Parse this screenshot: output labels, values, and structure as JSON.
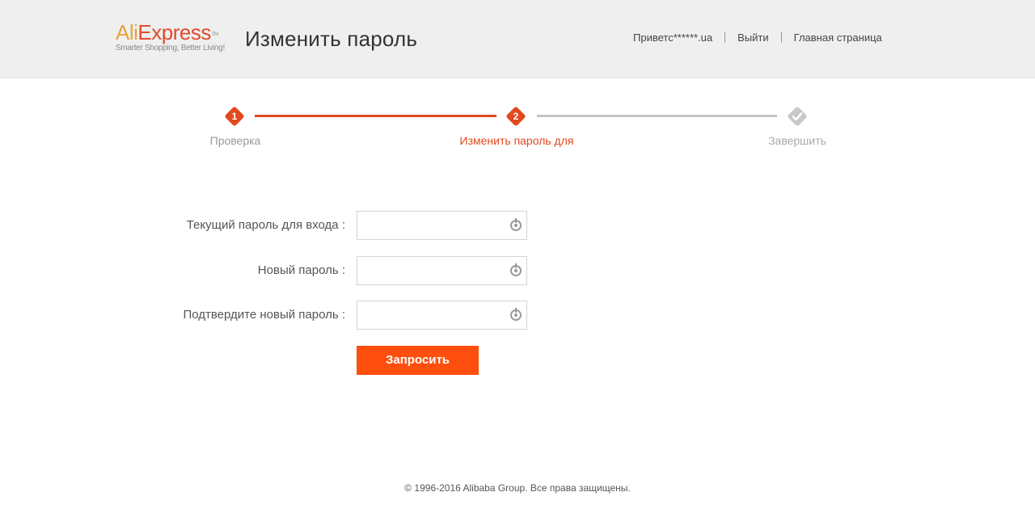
{
  "header": {
    "logo_main_a": "Ali",
    "logo_main_b": "Express",
    "logo_tm": "TM",
    "logo_tagline": "Smarter Shopping, Better Living!",
    "title": "Изменить пароль",
    "nav": {
      "greeting": "Приветс******.ua",
      "logout": "Выйти",
      "home": "Главная страница"
    }
  },
  "steps": [
    {
      "number": "1",
      "label": "Проверка",
      "state": "done"
    },
    {
      "number": "2",
      "label": "Изменить пароль для",
      "state": "active"
    },
    {
      "number": "",
      "label": "Завершить",
      "state": "pending",
      "icon": "checkmark-icon"
    }
  ],
  "form": {
    "current_password_label": "Текущий пароль для входа :",
    "current_password_value": "",
    "new_password_label": "Новый пароль :",
    "new_password_value": "",
    "confirm_password_label": "Подтвердите новый пароль :",
    "confirm_password_value": "",
    "submit_label": "Запросить"
  },
  "footer": {
    "copyright": "© 1996-2016 Alibaba Group. Все права защищены."
  },
  "colors": {
    "accent": "#e24a1e",
    "button": "#ff4f0e",
    "header_bg": "#efefef",
    "inactive": "#c4c4c4"
  }
}
